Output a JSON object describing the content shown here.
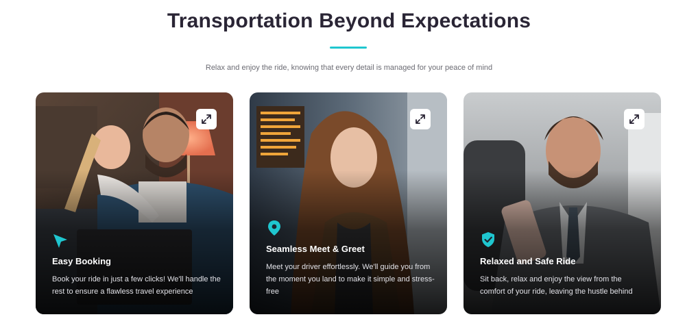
{
  "section": {
    "heading": "Transportation Beyond Expectations",
    "subtitle": "Relax and enjoy the ride, knowing that every detail is managed for your peace of mind",
    "accent_color": "#1fc6cf",
    "heading_color": "#2a2535"
  },
  "cards": [
    {
      "title": "Easy Booking",
      "text": "Book your ride in just a few clicks! We'll handle the rest to ensure a flawless travel experience",
      "icon": "navigation-arrow-icon",
      "photo": "father-and-daughter-with-laptop"
    },
    {
      "title": "Seamless Meet & Greet",
      "text": "Meet your driver effortlessly. We'll guide you from the moment you land to make it simple and stress-free",
      "icon": "map-pin-icon",
      "photo": "woman-in-airport-terminal"
    },
    {
      "title": "Relaxed and Safe Ride",
      "text": "Sit back, relax and enjoy the view from the comfort of your ride, leaving the hustle behind",
      "icon": "shield-check-icon",
      "photo": "businessman-in-car-with-phone"
    }
  ],
  "expand_icon": "expand-arrows-icon"
}
